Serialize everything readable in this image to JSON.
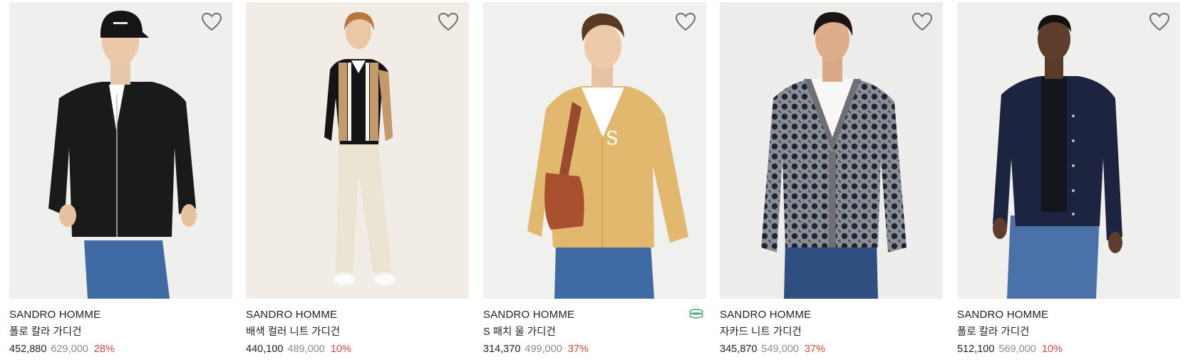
{
  "colors": {
    "discount": "#e0483f",
    "original_price": "#8c8c8c",
    "text": "#222222",
    "eco_icon": "#3ba36a"
  },
  "products": [
    {
      "brand": "SANDRO HOMME",
      "name": "폴로 칼라 가디건",
      "price": "452,880",
      "original_price": "629,000",
      "discount": "28%",
      "image": "model-black-zip-cardigan",
      "wishlist_icon": "heart-icon"
    },
    {
      "brand": "SANDRO HOMME",
      "name": "배색 컬러 니트 가디건",
      "price": "440,100",
      "original_price": "489,000",
      "discount": "10%",
      "image": "model-striped-cardigan",
      "wishlist_icon": "heart-icon"
    },
    {
      "brand": "SANDRO HOMME",
      "name": "S 패치 울 가디건",
      "price": "314,370",
      "original_price": "499,000",
      "discount": "37%",
      "image": "model-beige-s-patch-cardigan",
      "wishlist_icon": "heart-icon",
      "badge_icon": "eco-leaf-icon"
    },
    {
      "brand": "SANDRO HOMME",
      "name": "자카드 니트 가디건",
      "price": "345,870",
      "original_price": "549,000",
      "discount": "37%",
      "image": "model-jacquard-cardigan",
      "wishlist_icon": "heart-icon"
    },
    {
      "brand": "SANDRO HOMME",
      "name": "폴로 칼라 가디건",
      "price": "512,100",
      "original_price": "569,000",
      "discount": "10%",
      "image": "model-navy-polo-cardigan",
      "wishlist_icon": "heart-icon"
    }
  ]
}
